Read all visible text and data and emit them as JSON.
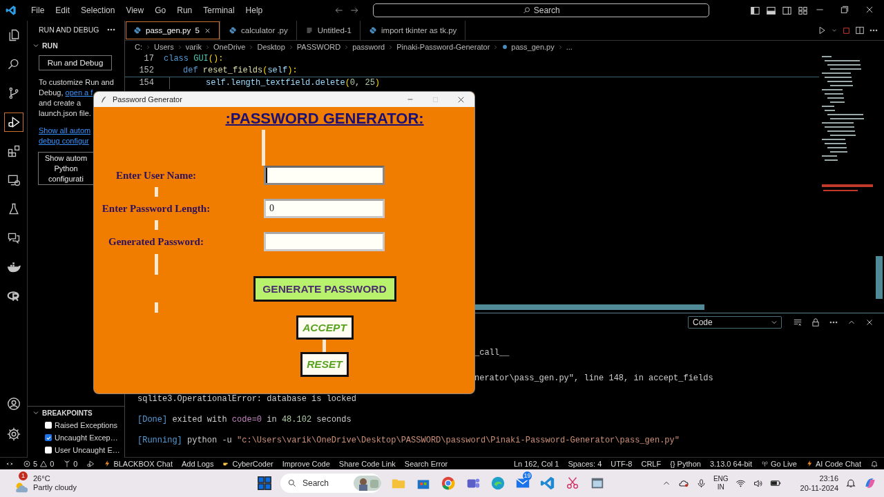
{
  "titlebar": {
    "menus": [
      "File",
      "Edit",
      "Selection",
      "View",
      "Go",
      "Run",
      "Terminal",
      "Help"
    ],
    "search": "Search"
  },
  "activity_bar": {
    "items": [
      {
        "kind": "files",
        "selected": false
      },
      {
        "kind": "search",
        "selected": false
      },
      {
        "kind": "source-control",
        "selected": false
      },
      {
        "kind": "run-debug",
        "selected": true
      },
      {
        "kind": "extensions",
        "selected": false
      },
      {
        "kind": "remote",
        "selected": false
      },
      {
        "kind": "testing",
        "selected": false
      },
      {
        "kind": "chat",
        "selected": false
      },
      {
        "kind": "docker",
        "selected": false
      },
      {
        "kind": "ring",
        "selected": false
      }
    ],
    "bottom": [
      {
        "kind": "account"
      },
      {
        "kind": "settings"
      }
    ]
  },
  "sidebar": {
    "title": "RUN AND DEBUG",
    "section": "RUN",
    "run_button": "Run and Debug",
    "intro": [
      {
        "text": "To customize Run and"
      },
      {
        "text": "Debug,",
        "link": "open a f"
      },
      {
        "text": "and create a"
      },
      {
        "text": "launch.json file."
      }
    ],
    "auto_link": [
      "Show all autom",
      "debug configur"
    ],
    "show_button": [
      "Show autom",
      "Python",
      "configurati"
    ],
    "breakpoints": {
      "title": "BREAKPOINTS",
      "items": [
        {
          "label": "Raised Exceptions",
          "checked": false
        },
        {
          "label": "Uncaught Excep…",
          "checked": true
        },
        {
          "label": "User Uncaught E…",
          "checked": false
        }
      ]
    }
  },
  "editor": {
    "tabs": [
      {
        "label": "pass_gen.py",
        "badge": "5",
        "selected": true,
        "kind": "python"
      },
      {
        "label": "calculator .py",
        "selected": false,
        "kind": "python"
      },
      {
        "label": "Untitled-1",
        "selected": false,
        "kind": "text"
      },
      {
        "label": "import tkinter as tk.py",
        "selected": false,
        "kind": "python"
      }
    ],
    "breadcrumb": [
      "C:",
      "Users",
      "varik",
      "OneDrive",
      "Desktop",
      "PASSWORD",
      "password",
      "Pinaki-Password-Generator",
      "pass_gen.py",
      "..."
    ],
    "code": [
      {
        "number": "17",
        "sticky": true,
        "tokens": [
          {
            "text": "class",
            "kind": "keyword"
          },
          {
            "text": "GUI",
            "kind": "type"
          },
          {
            "text": "():",
            "kind": "paren"
          }
        ],
        "children": [
          {
            "number": "152",
            "sticky": true,
            "tokens": [
              {
                "text": "def",
                "kind": "keyword"
              },
              {
                "text": "reset_fields",
                "kind": "function"
              },
              {
                "text": "(",
                "kind": "paren"
              },
              {
                "text": "self",
                "kind": "variable"
              },
              {
                "text": "):",
                "kind": "paren"
              }
            ],
            "children": [
              {
                "number": "154",
                "sticky": false,
                "tokens": [
                  {
                    "text": "self.length_textfield.delete",
                    "kind": "variable"
                  },
                  {
                    "text": "(",
                    "kind": "paren"
                  },
                  {
                    "text": "0",
                    "kind": "number"
                  },
                  {
                    "text": ", "
                  },
                  {
                    "text": "25",
                    "kind": "number"
                  },
                  {
                    "text": ")",
                    "kind": "paren"
                  }
                ]
              }
            ]
          }
        ]
      }
    ]
  },
  "panel": {
    "dropdown": "Code",
    "lines": [
      {
        "kind": "partial",
        "parts": [
          {
            "text": "_call__"
          }
        ]
      },
      {
        "kind": "partial",
        "parts": [
          {
            "text": "nerator\\pass_gen.py\", line 148, in accept_fields"
          }
        ]
      },
      {
        "kind": "full",
        "parts": [
          {
            "text": "sqlite3.OperationalError: database is locked"
          }
        ]
      },
      {
        "kind": "full",
        "parts": [
          {
            "text": "[Done]",
            "color": "#569cd6"
          },
          {
            "text": " exited with "
          },
          {
            "text": "code=0",
            "color": "#c586c0"
          },
          {
            "text": " in "
          },
          {
            "text": "48.102",
            "color": "#b5cea8"
          },
          {
            "text": " seconds"
          }
        ]
      },
      {
        "kind": "full",
        "parts": [
          {
            "text": "[Running]",
            "color": "#569cd6"
          },
          {
            "text": " python -u "
          },
          {
            "text": "\"c:\\Users\\varik\\OneDrive\\Desktop\\PASSWORD\\password\\Pinaki-Password-Generator\\pass_gen.py\"",
            "color": "#ce9178"
          }
        ]
      }
    ]
  },
  "status_bar": {
    "errors": "5",
    "warnings": "0",
    "ports": "0",
    "left": [
      {
        "text": "BLACKBOX Chat",
        "kind": "bolt"
      },
      {
        "text": "Add Logs",
        "kind": "plain"
      },
      {
        "text": "CyberCoder",
        "kind": "hand"
      },
      {
        "text": "Improve Code",
        "kind": "plain"
      },
      {
        "text": "Share Code Link",
        "kind": "plain"
      },
      {
        "text": "Search Error",
        "kind": "plain"
      }
    ],
    "right": [
      {
        "text": "Ln 162, Col 1",
        "kind": "plain"
      },
      {
        "text": "Spaces: 4",
        "kind": "plain"
      },
      {
        "text": "UTF-8",
        "kind": "plain"
      },
      {
        "text": "CRLF",
        "kind": "plain"
      },
      {
        "text": "{} Python",
        "kind": "plain"
      },
      {
        "text": "3.13.0 64-bit",
        "kind": "plain"
      },
      {
        "text": "Go Live",
        "kind": "broadcast"
      },
      {
        "text": "AI Code Chat",
        "kind": "bolt"
      }
    ]
  },
  "taskbar": {
    "weather": {
      "badge": "1",
      "temperature": "26°C",
      "condition": "Partly cloudy"
    },
    "search": "Search",
    "apps": [
      {
        "kind": "folder"
      },
      {
        "kind": "store"
      },
      {
        "kind": "browser"
      },
      {
        "kind": "teams"
      },
      {
        "kind": "edge"
      },
      {
        "kind": "mail",
        "badge": "19"
      },
      {
        "kind": "code"
      },
      {
        "kind": "snip"
      },
      {
        "kind": "app"
      }
    ],
    "language": [
      "ENG",
      "IN"
    ],
    "time": "23:16",
    "date": "20-11-2024"
  },
  "tk_window": {
    "title": "Password Generator",
    "maximize_disabled": true,
    "heading": ":PASSWORD GENERATOR:",
    "fields": [
      {
        "label": "Enter User Name:",
        "focused": true
      },
      {
        "label": "Enter Password Length:",
        "value": "0",
        "focused": false
      },
      {
        "label": "Generated Password:",
        "focused": false
      }
    ],
    "generate_button": "GENERATE PASSWORD",
    "accept_button": "ACCEPT",
    "reset_button": "RESET"
  }
}
